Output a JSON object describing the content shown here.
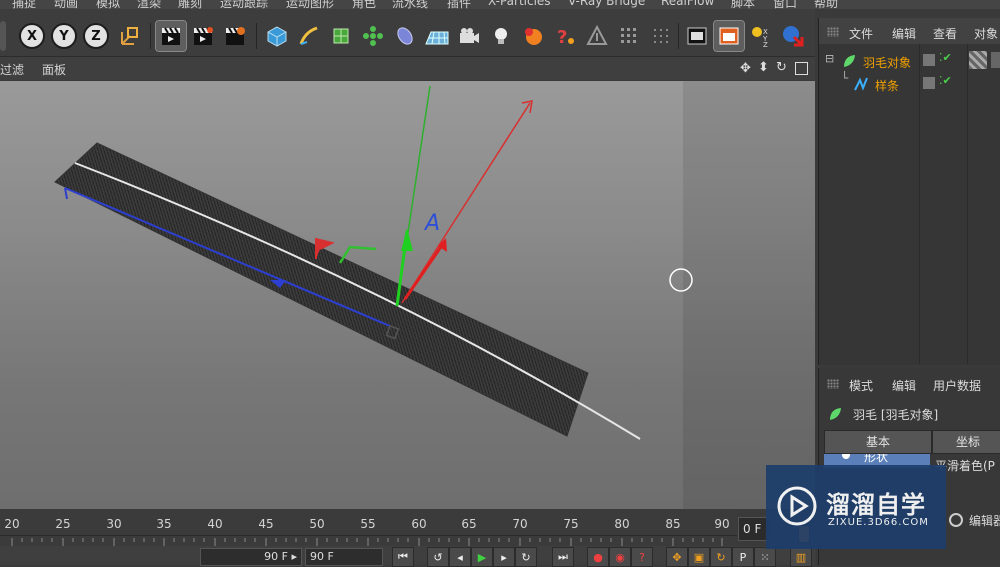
{
  "menu": [
    "捕捉",
    "动画",
    "模拟",
    "渲染",
    "雕刻",
    "运动跟踪",
    "运动图形",
    "角色",
    "流水线",
    "插件",
    "X-Particles",
    "V-Ray Bridge",
    "RealFlow",
    "脚本",
    "窗口",
    "帮助"
  ],
  "toolbar": {
    "axis_x": "X",
    "axis_y": "Y",
    "axis_z": "Z"
  },
  "viewport_menu": [
    "过滤",
    "面板"
  ],
  "viewport_axis_label": "A",
  "timeline": {
    "ticks": [
      "20",
      "25",
      "30",
      "35",
      "40",
      "45",
      "50",
      "55",
      "60",
      "65",
      "70",
      "75",
      "80",
      "85",
      "90"
    ],
    "current_frame": "0 F"
  },
  "bottom": {
    "end_frame_left": "90 F ▸",
    "end_frame_field": "90 F"
  },
  "object_manager": {
    "menu": [
      "文件",
      "编辑",
      "查看",
      "对象"
    ],
    "objects": [
      {
        "name": "羽毛对象",
        "color": "#f0a000"
      },
      {
        "name": "样条",
        "color": "#f0a000"
      }
    ]
  },
  "attribute_manager": {
    "menu": [
      "模式",
      "编辑",
      "用户数据"
    ],
    "title": "羽毛 [羽毛对象]",
    "tabs": [
      "基本",
      "坐标"
    ],
    "row_left": "形状",
    "row_right": "平滑着色(P",
    "extra": "编辑器"
  },
  "watermark": {
    "title": "溜溜自学",
    "url": "ZIXUE.3D66.COM"
  }
}
